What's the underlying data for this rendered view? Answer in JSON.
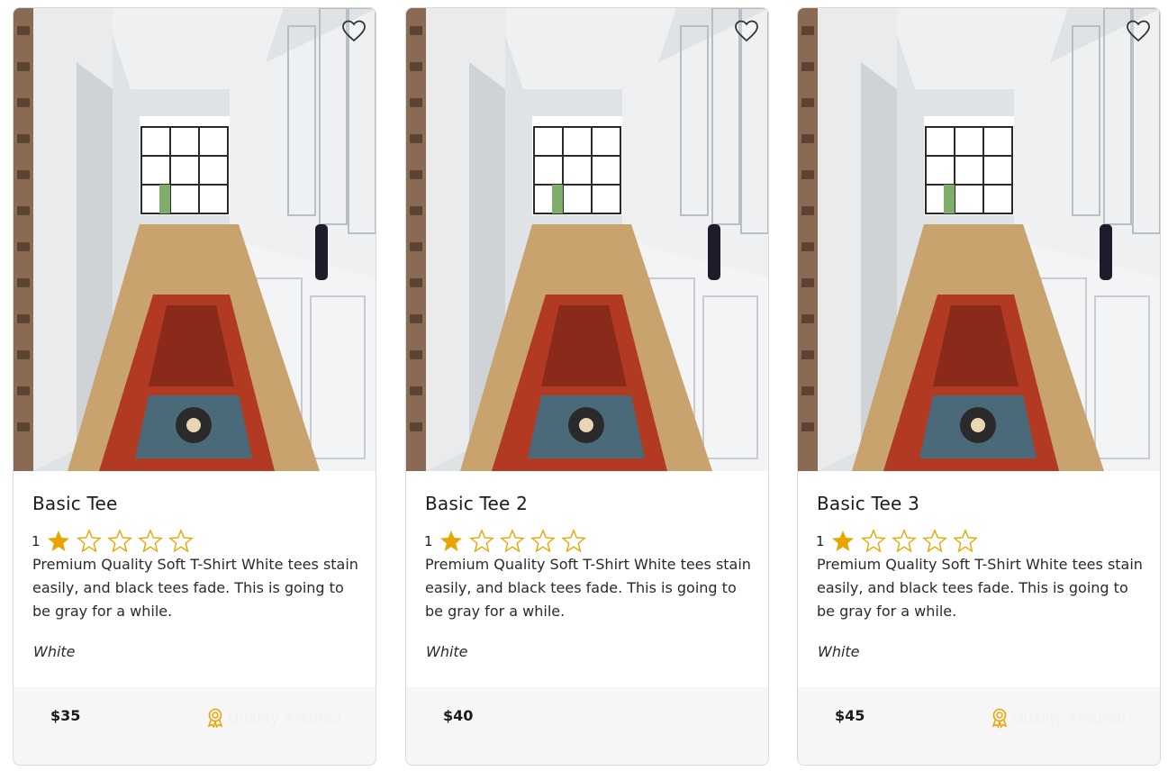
{
  "products": [
    {
      "title": "Basic Tee",
      "rating": "1",
      "description": "Premium Quality Soft T-Shirt White tees stain easily, and black tees fade. This is going to be gray for a while.",
      "color": "White",
      "price": "$35",
      "badge": "Quality Assured"
    },
    {
      "title": "Basic Tee 2",
      "rating": "1",
      "description": "Premium Quality Soft T-Shirt White tees stain easily, and black tees fade. This is going to be gray for a while.",
      "color": "White",
      "price": "$40",
      "badge": ""
    },
    {
      "title": "Basic Tee 3",
      "rating": "1",
      "description": "Premium Quality Soft T-Shirt White tees stain easily, and black tees fade. This is going to be gray for a while.",
      "color": "White",
      "price": "$45",
      "badge": "Quality Assured"
    }
  ],
  "icons": {
    "favorite": "heart-icon",
    "star_filled": "star-filled-icon",
    "star_empty": "star-outline-icon",
    "badge": "award-ribbon-icon"
  },
  "colors": {
    "star": "#E8A500",
    "badge_icon": "#E8A500",
    "footer_bg": "#F6F6F6"
  }
}
